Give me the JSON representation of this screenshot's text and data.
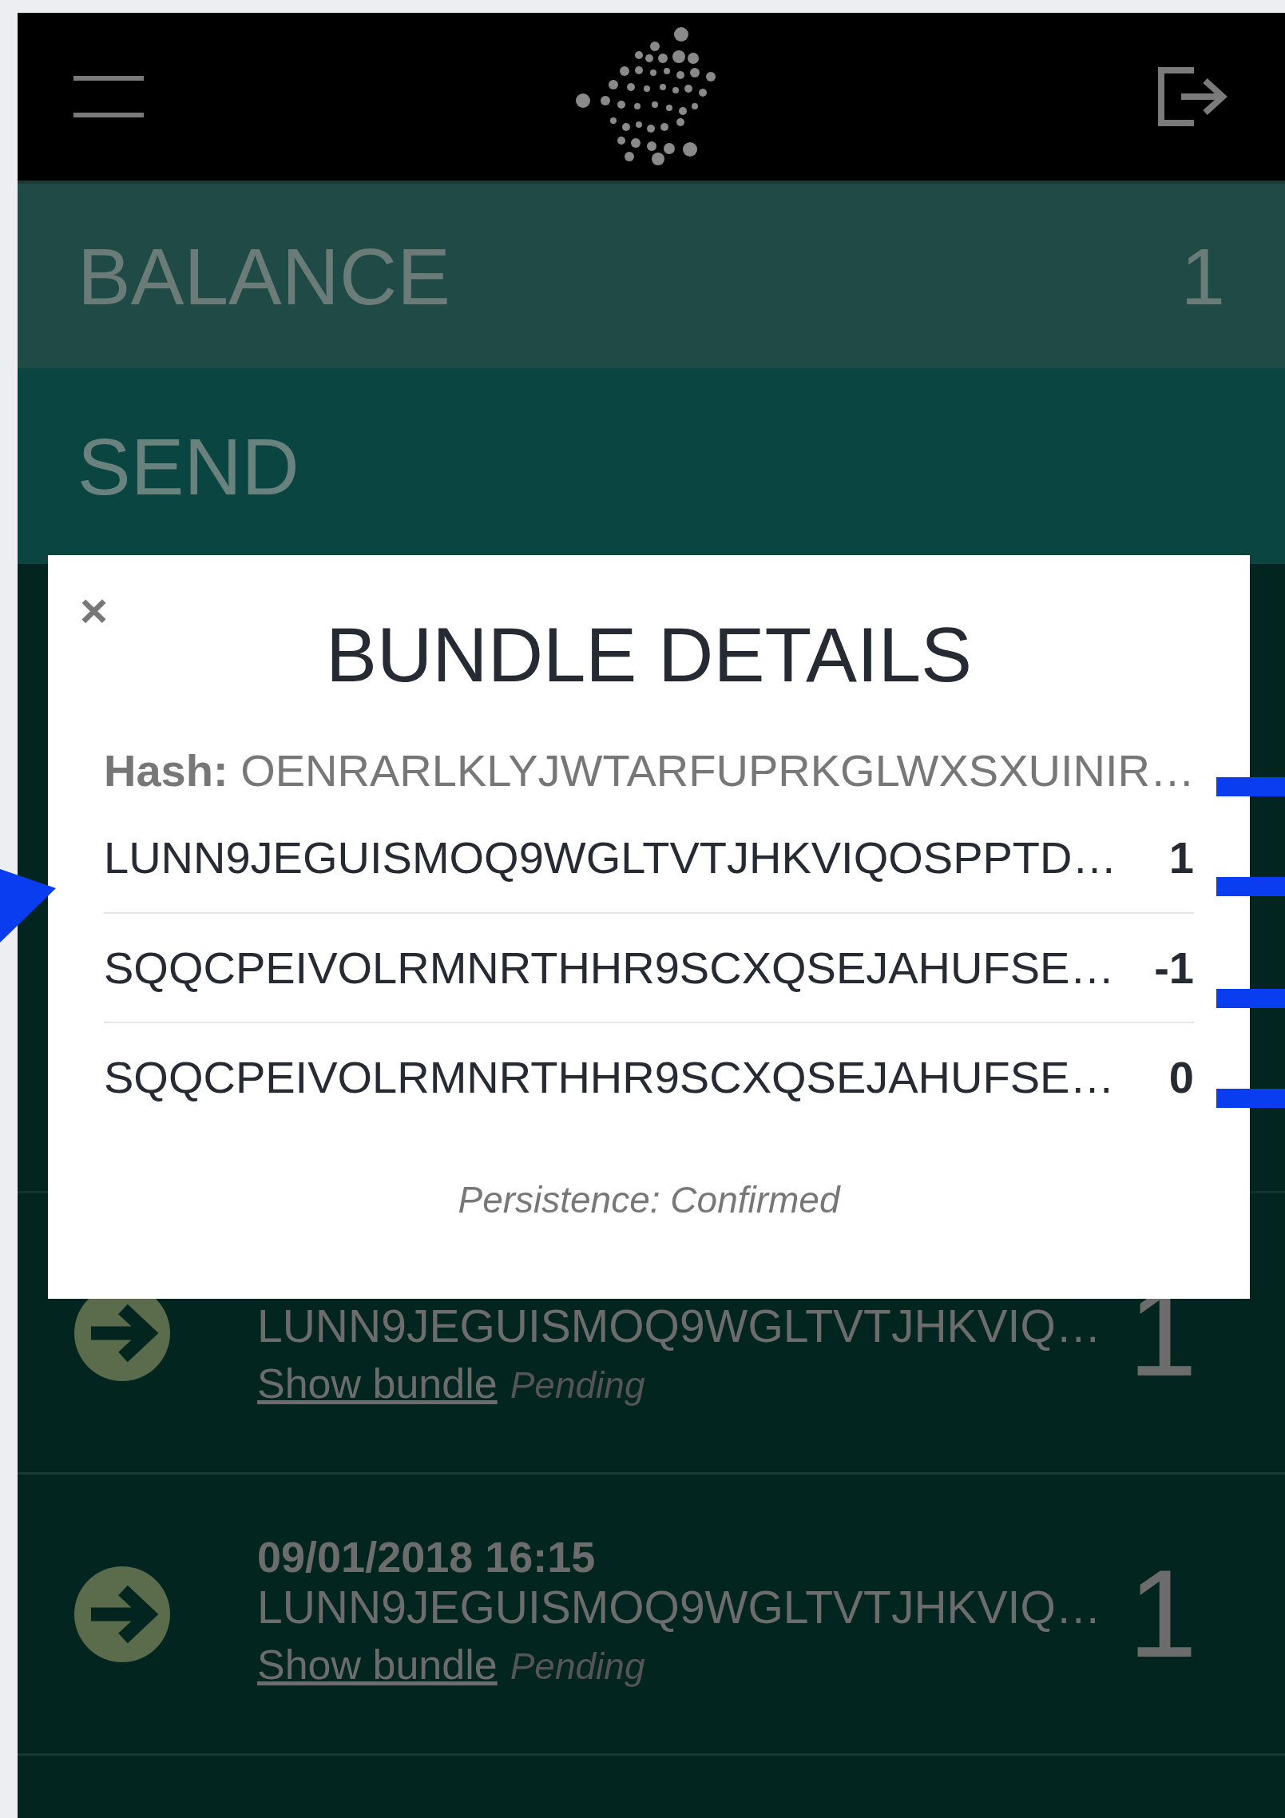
{
  "balance": {
    "label": "BALANCE",
    "value": "1"
  },
  "send": {
    "label": "SEND"
  },
  "transactions": [
    {
      "address": "LUNN9JEGUISMOQ9WGLTVTJHKVIQ…",
      "link": "Show bundle",
      "status": "Pending",
      "value": "1"
    },
    {
      "date": "09/01/2018 16:15",
      "address": "LUNN9JEGUISMOQ9WGLTVTJHKVIQ…",
      "link": "Show bundle",
      "status": "Pending",
      "value": "1"
    }
  ],
  "modal": {
    "close": "×",
    "title": "BUNDLE DETAILS",
    "hash": "**Hash:** OENRARLKLYJWTARFUPRKGLWXSXUINIR…",
    "rows": [
      {
        "address": "LUNN9JEGUISMOQ9WGLTVTJHKVIQOSPPTD…",
        "value": "1"
      },
      {
        "address": "SQQCPEIVOLRMNRTHHR9SCXQSEJAHUFSE…",
        "value": "-1"
      },
      {
        "address": "SQQCPEIVOLRMNRTHHR9SCXQSEJAHUFSE…",
        "value": "0"
      }
    ],
    "persistence": "Persistence: Confirmed"
  }
}
